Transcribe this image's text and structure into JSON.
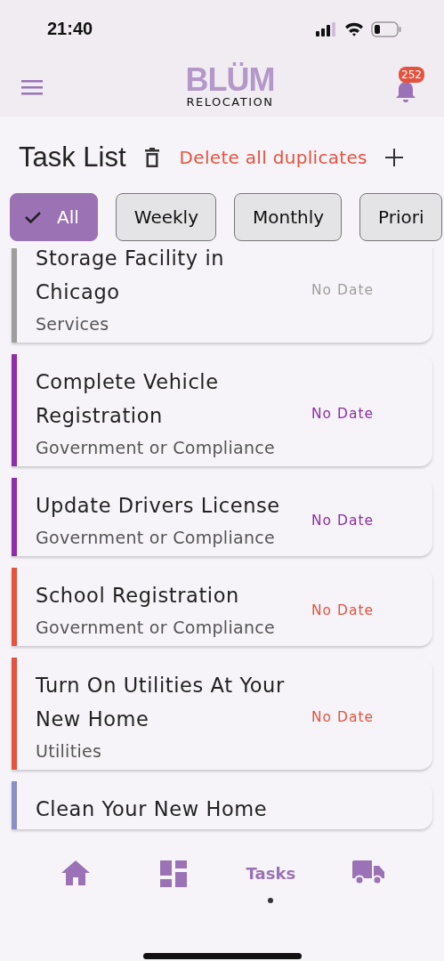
{
  "status_bar": {
    "time": "21:40"
  },
  "header": {
    "logo_title": "BLÜM",
    "logo_subtitle": "RELOCATION",
    "notification_count": "252"
  },
  "toolbar": {
    "title": "Task List",
    "delete_link": "Delete all duplicates"
  },
  "filters": [
    {
      "label": "All",
      "selected": true
    },
    {
      "label": "Weekly",
      "selected": false
    },
    {
      "label": "Monthly",
      "selected": false
    },
    {
      "label": "Priori",
      "selected": false
    }
  ],
  "tasks": [
    {
      "title": "Storage Facility in Chicago",
      "category": "Services",
      "date": "No Date",
      "color": "#9e9e9e"
    },
    {
      "title": "Complete Vehicle Registration",
      "category": "Government or Compliance",
      "date": "No Date",
      "color": "#8e2fa8"
    },
    {
      "title": "Update Drivers License",
      "category": "Government or Compliance",
      "date": "No Date",
      "color": "#8e2fa8"
    },
    {
      "title": "School Registration",
      "category": "Government or Compliance",
      "date": "No Date",
      "color": "#e5533f"
    },
    {
      "title": "Turn On Utilities At Your New Home",
      "category": "Utilities",
      "date": "No Date",
      "color": "#e5533f"
    },
    {
      "title": "Clean Your New Home",
      "color": "#8c8fc4"
    }
  ],
  "bottom_nav": [
    {
      "kind": "home",
      "selected": false
    },
    {
      "kind": "dashboard",
      "selected": false
    },
    {
      "label": "Tasks",
      "selected": true
    },
    {
      "kind": "truck",
      "selected": false
    }
  ]
}
